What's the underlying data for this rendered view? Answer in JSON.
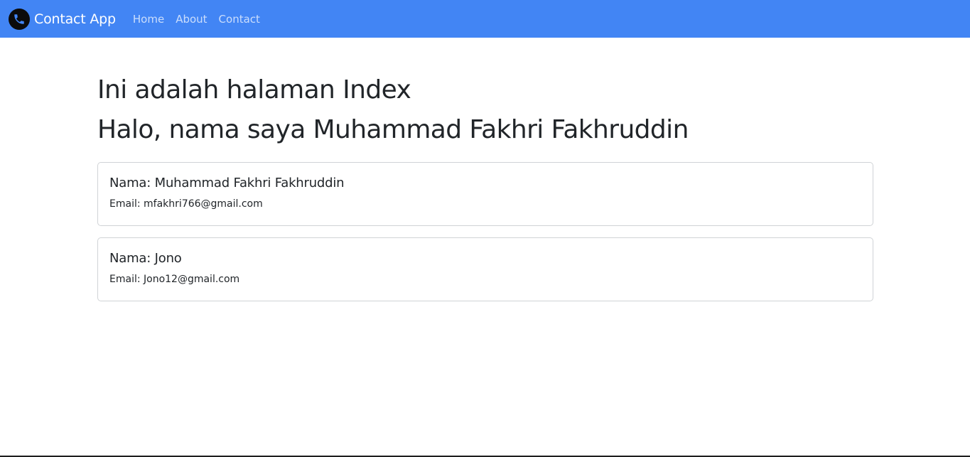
{
  "navbar": {
    "brand": {
      "icon": "phone-icon",
      "label": "Contact App"
    },
    "links": [
      {
        "label": "Home"
      },
      {
        "label": "About"
      },
      {
        "label": "Contact"
      }
    ],
    "background_color": "#4285f4"
  },
  "main": {
    "heading_line1": "Ini adalah halaman Index",
    "heading_line2": "Halo, nama saya Muhammad Fakhri Fakhruddin",
    "contacts": [
      {
        "name": "Nama: Muhammad Fakhri Fakhruddin",
        "email": "Email: mfakhri766@gmail.com"
      },
      {
        "name": "Nama: Jono",
        "email": "Email: Jono12@gmail.com"
      }
    ]
  }
}
